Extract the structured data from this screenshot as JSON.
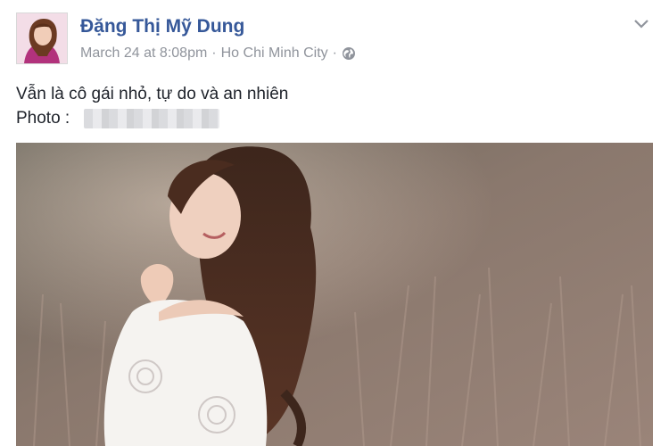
{
  "post": {
    "author_name": "Đặng Thị Mỹ Dung",
    "timestamp": "March 24 at 8:08pm",
    "separator": "·",
    "location": "Ho Chi Minh City",
    "privacy_icon": "globe-icon",
    "menu_icon": "chevron-down-icon",
    "text_line_1": "Vẫn là cô gái nhỏ, tự do và an nhiên",
    "text_line_2": "Photo :",
    "photo_credit_redacted": true
  },
  "colors": {
    "name_blue": "#365899",
    "meta_gray": "#90949c",
    "text": "#1d2129"
  }
}
